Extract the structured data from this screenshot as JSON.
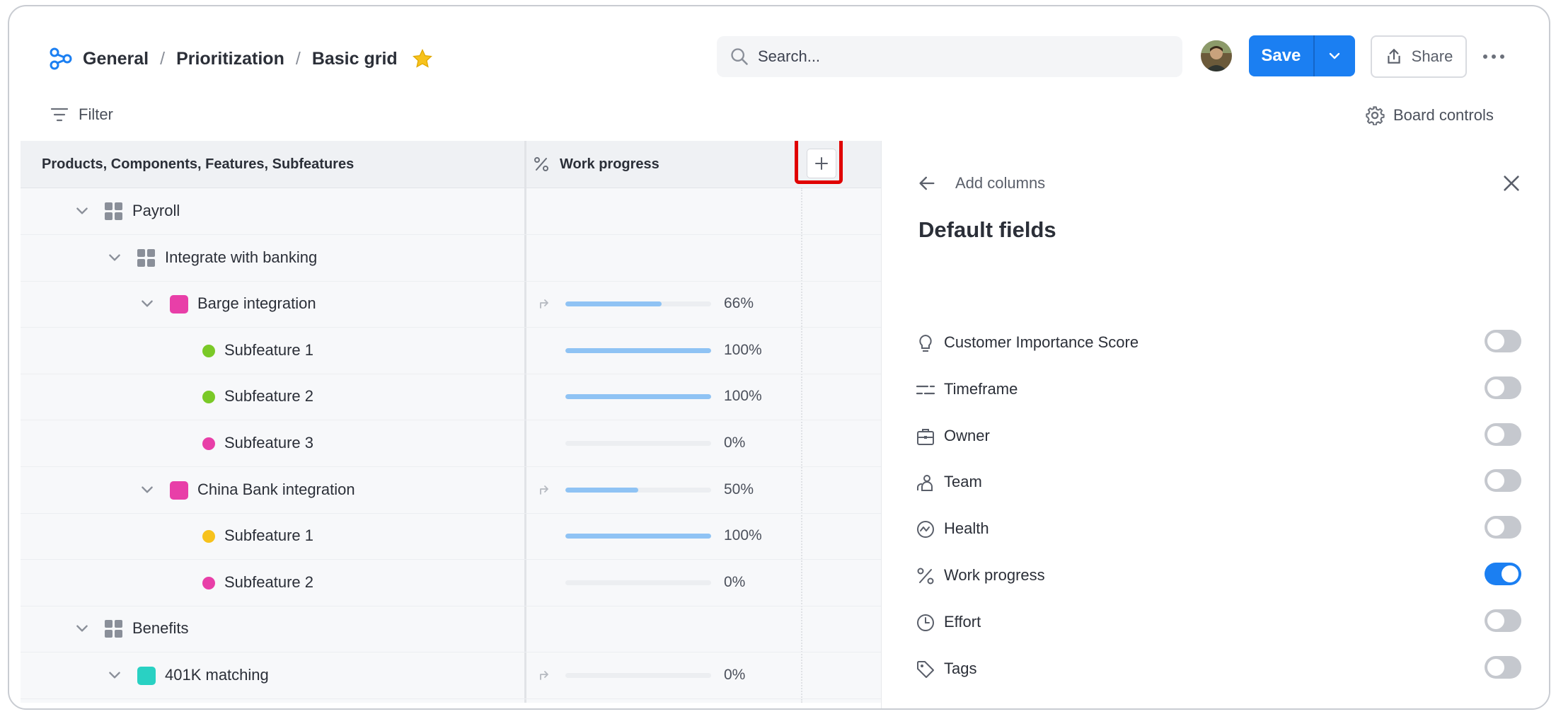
{
  "breadcrumb": {
    "items": [
      "General",
      "Prioritization",
      "Basic grid"
    ],
    "separator": "/"
  },
  "search": {
    "placeholder": "Search..."
  },
  "toolbar": {
    "save_label": "Save",
    "share_label": "Share",
    "filter_label": "Filter",
    "board_controls_label": "Board controls"
  },
  "grid": {
    "headers": {
      "name": "Products, Components, Features, Subfeatures",
      "progress": "Work progress"
    },
    "rows": [
      {
        "name": "Payroll",
        "type": "component",
        "level": 1,
        "expanded": true,
        "progress": null,
        "progress_label": ""
      },
      {
        "name": "Integrate with banking",
        "type": "component",
        "level": 2,
        "expanded": true,
        "progress": null,
        "progress_label": ""
      },
      {
        "name": "Barge integration",
        "type": "feature",
        "color": "#e83fa8",
        "level": 3,
        "expanded": true,
        "progress": 66,
        "progress_label": "66%",
        "rollup": true
      },
      {
        "name": "Subfeature 1",
        "type": "subfeature",
        "color": "#7ac927",
        "level": 4,
        "progress": 100,
        "progress_label": "100%"
      },
      {
        "name": "Subfeature 2",
        "type": "subfeature",
        "color": "#7ac927",
        "level": 4,
        "progress": 100,
        "progress_label": "100%"
      },
      {
        "name": "Subfeature 3",
        "type": "subfeature",
        "color": "#e83fa8",
        "level": 4,
        "progress": 0,
        "progress_label": "0%"
      },
      {
        "name": "China Bank integration",
        "type": "feature",
        "color": "#e83fa8",
        "level": 3,
        "expanded": true,
        "progress": 50,
        "progress_label": "50%",
        "rollup": true
      },
      {
        "name": "Subfeature 1",
        "type": "subfeature",
        "color": "#f7c21c",
        "level": 4,
        "progress": 100,
        "progress_label": "100%"
      },
      {
        "name": "Subfeature 2",
        "type": "subfeature",
        "color": "#e83fa8",
        "level": 4,
        "progress": 0,
        "progress_label": "0%"
      },
      {
        "name": "Benefits",
        "type": "component",
        "level": 1,
        "expanded": true,
        "progress": null,
        "progress_label": ""
      },
      {
        "name": "401K matching",
        "type": "feature",
        "color": "#29d1c3",
        "level": 2,
        "expanded": true,
        "progress": 0,
        "progress_label": "0%",
        "rollup": true
      }
    ]
  },
  "panel": {
    "title": "Add columns",
    "section_title": "Default fields",
    "fields": [
      {
        "label": "Customer Importance Score",
        "icon": "lightbulb-icon",
        "enabled": false
      },
      {
        "label": "Timeframe",
        "icon": "timeframe-icon",
        "enabled": false
      },
      {
        "label": "Owner",
        "icon": "id-badge-icon",
        "enabled": false
      },
      {
        "label": "Team",
        "icon": "team-icon",
        "enabled": false
      },
      {
        "label": "Health",
        "icon": "health-icon",
        "enabled": false
      },
      {
        "label": "Work progress",
        "icon": "percent-icon",
        "enabled": true
      },
      {
        "label": "Effort",
        "icon": "clock-icon",
        "enabled": false
      },
      {
        "label": "Tags",
        "icon": "tag-icon",
        "enabled": false
      }
    ]
  },
  "colors": {
    "accent": "#1b7ff2",
    "progress_fill": "#8fc3f4",
    "highlight": "#e00000",
    "star": "#f7c21c"
  }
}
